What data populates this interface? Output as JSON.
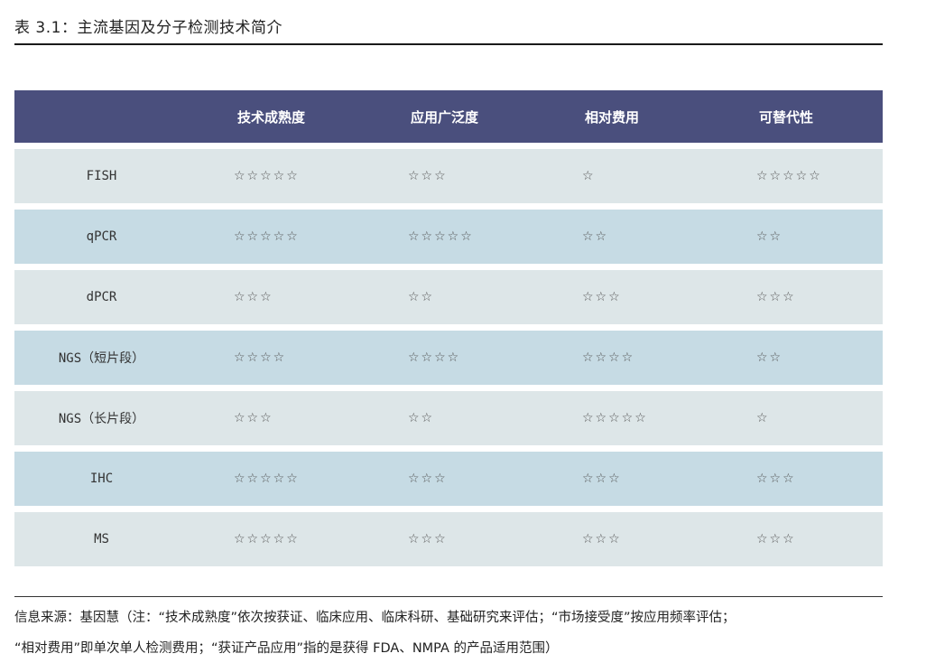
{
  "title": "表 3.1：主流基因及分子检测技术简介",
  "table": {
    "headers": [
      "",
      "技术成熟度",
      "应用广泛度",
      "相对费用",
      "可替代性"
    ],
    "rows": [
      {
        "name": "FISH",
        "cells": [
          "☆☆☆☆☆",
          "☆☆☆",
          "☆",
          "☆☆☆☆☆"
        ]
      },
      {
        "name": "qPCR",
        "cells": [
          "☆☆☆☆☆",
          "☆☆☆☆☆",
          "☆☆",
          "☆☆"
        ]
      },
      {
        "name": "dPCR",
        "cells": [
          "☆☆☆",
          "☆☆",
          "☆☆☆",
          "☆☆☆"
        ]
      },
      {
        "name": "NGS（短片段）",
        "cells": [
          "☆☆☆☆",
          "☆☆☆☆",
          "☆☆☆☆",
          "☆☆"
        ]
      },
      {
        "name": "NGS（长片段）",
        "cells": [
          "☆☆☆",
          "☆☆",
          "☆☆☆☆☆",
          "☆"
        ]
      },
      {
        "name": "IHC",
        "cells": [
          "☆☆☆☆☆",
          "☆☆☆",
          "☆☆☆",
          "☆☆☆"
        ]
      },
      {
        "name": "MS",
        "cells": [
          "☆☆☆☆☆",
          "☆☆☆",
          "☆☆☆",
          "☆☆☆"
        ]
      }
    ]
  },
  "footnote": {
    "line1": "信息来源：基因慧（注：“技术成熟度”依次按获证、临床应用、临床科研、基础研究来评估；“市场接受度”按应用频率评估；",
    "line2": "“相对费用”即单次单人检测费用；“获证产品应用”指的是获得 FDA、NMPA 的产品适用范围）"
  },
  "colors": {
    "header_bg": "#4a4f7d",
    "row_light": "#dde6e8",
    "row_blue": "#c6dbe4"
  }
}
